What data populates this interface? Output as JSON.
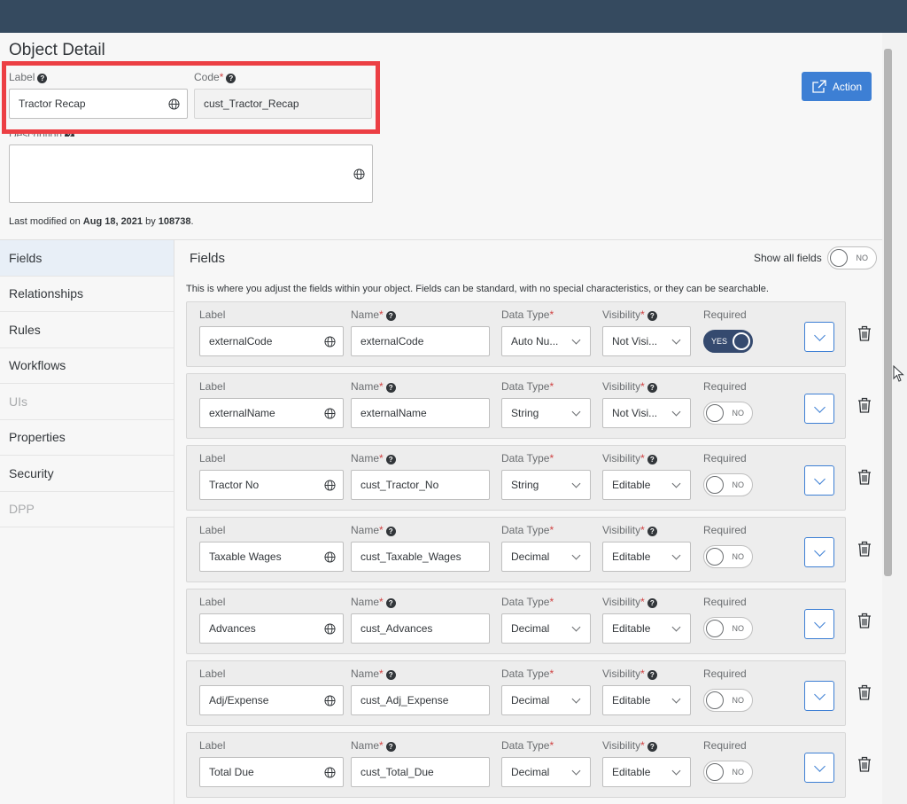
{
  "header": {
    "title": "Object Detail",
    "action_label": "Action",
    "action_icon": "external-link-icon"
  },
  "object": {
    "label_caption": "Label",
    "label_value": "Tractor Recap",
    "code_caption": "Code",
    "code_value": "cust_Tractor_Recap",
    "description_caption": "Description",
    "description_value": ""
  },
  "modified": {
    "prefix": "Last modified on ",
    "date": "Aug 18, 2021",
    "by": " by ",
    "user": "108738",
    "suffix": "."
  },
  "sidebar": {
    "items": [
      {
        "label": "Fields",
        "active": true,
        "disabled": false
      },
      {
        "label": "Relationships",
        "active": false,
        "disabled": false
      },
      {
        "label": "Rules",
        "active": false,
        "disabled": false
      },
      {
        "label": "Workflows",
        "active": false,
        "disabled": false
      },
      {
        "label": "UIs",
        "active": false,
        "disabled": true
      },
      {
        "label": "Properties",
        "active": false,
        "disabled": false
      },
      {
        "label": "Security",
        "active": false,
        "disabled": false
      },
      {
        "label": "DPP",
        "active": false,
        "disabled": true
      }
    ]
  },
  "fields_section": {
    "title": "Fields",
    "show_all_label": "Show all fields",
    "show_all_state": "NO",
    "intro": "This is where you adjust the fields within your object. Fields can be standard, with no special characteristics, or they can be searchable.",
    "col_label": "Label",
    "col_name": "Name",
    "col_type": "Data Type",
    "col_visibility": "Visibility",
    "col_required": "Required"
  },
  "fields": [
    {
      "label": "externalCode",
      "name": "externalCode",
      "type": "Auto Nu...",
      "visibility": "Not Visi...",
      "required": "YES"
    },
    {
      "label": "externalName",
      "name": "externalName",
      "type": "String",
      "visibility": "Not Visi...",
      "required": "NO"
    },
    {
      "label": "Tractor No",
      "name": "cust_Tractor_No",
      "type": "String",
      "visibility": "Editable",
      "required": "NO"
    },
    {
      "label": "Taxable Wages",
      "name": "cust_Taxable_Wages",
      "type": "Decimal",
      "visibility": "Editable",
      "required": "NO"
    },
    {
      "label": "Advances",
      "name": "cust_Advances",
      "type": "Decimal",
      "visibility": "Editable",
      "required": "NO"
    },
    {
      "label": "Adj/Expense",
      "name": "cust_Adj_Expense",
      "type": "Decimal",
      "visibility": "Editable",
      "required": "NO"
    },
    {
      "label": "Total Due",
      "name": "cust_Total_Due",
      "type": "Decimal",
      "visibility": "Editable",
      "required": "NO"
    }
  ],
  "colors": {
    "shell": "#354a5f",
    "accent": "#3d7fd4",
    "highlight": "#ec3f44",
    "toggle_on": "#354a6f"
  }
}
